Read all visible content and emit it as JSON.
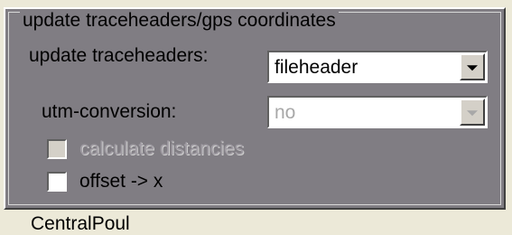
{
  "group": {
    "title": "update traceheaders/gps coordinates"
  },
  "update_traceheaders": {
    "label": "update traceheaders:",
    "value": "fileheader"
  },
  "utm_conversion": {
    "label": "utm-conversion:",
    "value": "no"
  },
  "calculate_distancies": {
    "label": "calculate distancies",
    "checked": false,
    "enabled": false
  },
  "offset_x": {
    "label": "offset -> x",
    "checked": false,
    "enabled": true
  },
  "next_group": {
    "label": "CentralPoul"
  },
  "icons": {
    "combo_arrow": "chevron-down-icon"
  },
  "colors": {
    "panel_bg": "#807d83",
    "window_bg": "#ece9d8",
    "disabled_text": "#a09ca3"
  }
}
